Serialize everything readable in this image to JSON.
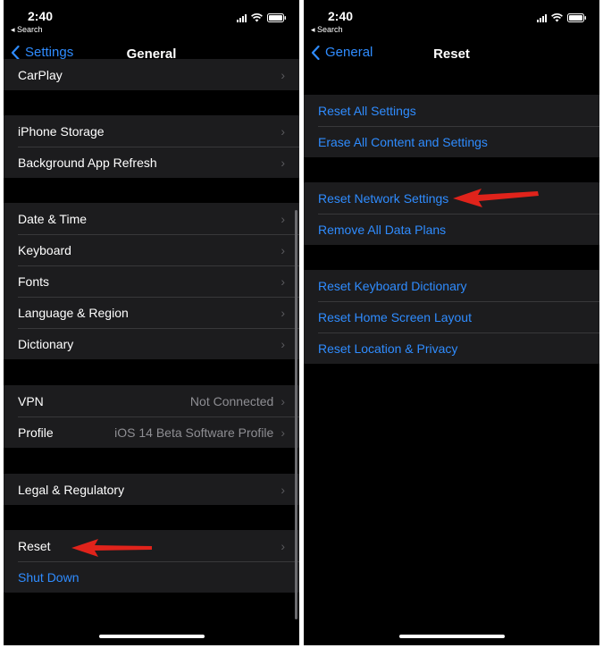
{
  "left_screen": {
    "status": {
      "time": "2:40",
      "back_app": "◂ Search"
    },
    "nav": {
      "back_label": "Settings",
      "title": "General"
    },
    "groups": [
      [
        {
          "label": "CarPlay"
        }
      ],
      [
        {
          "label": "iPhone Storage"
        },
        {
          "label": "Background App Refresh"
        }
      ],
      [
        {
          "label": "Date & Time"
        },
        {
          "label": "Keyboard"
        },
        {
          "label": "Fonts"
        },
        {
          "label": "Language & Region"
        },
        {
          "label": "Dictionary"
        }
      ],
      [
        {
          "label": "VPN",
          "value": "Not Connected"
        },
        {
          "label": "Profile",
          "value": "iOS 14 Beta Software Profile"
        }
      ],
      [
        {
          "label": "Legal & Regulatory"
        }
      ],
      [
        {
          "label": "Reset"
        },
        {
          "label": "Shut Down"
        }
      ]
    ]
  },
  "right_screen": {
    "status": {
      "time": "2:40",
      "back_app": "◂ Search"
    },
    "nav": {
      "back_label": "General",
      "title": "Reset"
    },
    "groups": [
      [
        {
          "label": "Reset All Settings"
        },
        {
          "label": "Erase All Content and Settings"
        }
      ],
      [
        {
          "label": "Reset Network Settings"
        },
        {
          "label": "Remove All Data Plans"
        }
      ],
      [
        {
          "label": "Reset Keyboard Dictionary"
        },
        {
          "label": "Reset Home Screen Layout"
        },
        {
          "label": "Reset Location & Privacy"
        }
      ]
    ]
  },
  "icons": {
    "chevron": "›",
    "annotation_arrow_color": "#e0231b",
    "link_color": "#2f8cff"
  }
}
